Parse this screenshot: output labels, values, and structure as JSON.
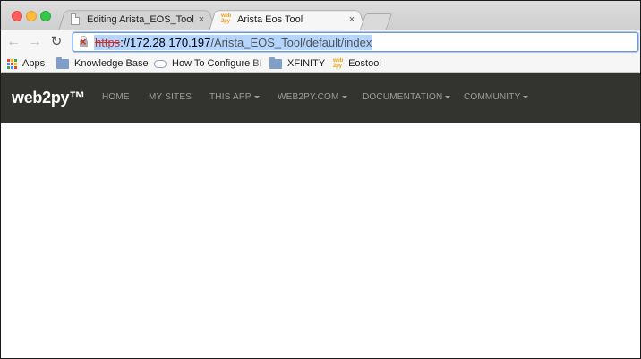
{
  "browser": {
    "tabs": [
      {
        "title": "Editing Arista_EOS_Tool",
        "favicon": "document-icon",
        "close": "×"
      },
      {
        "title": "Arista Eos Tool",
        "favicon": "web2py-icon",
        "close": "×"
      }
    ],
    "address": {
      "scheme": "https",
      "host": "://172.28.170.197",
      "path": "/Arista_EOS_Tool/default/index"
    },
    "bookmarks": [
      {
        "label": "Apps",
        "icon": "apps-grid-icon"
      },
      {
        "label": "Knowledge Base",
        "icon": "folder-icon"
      },
      {
        "label": "How To Configure BI",
        "icon": "cloud-icon"
      },
      {
        "label": "XFINITY",
        "icon": "folder-icon"
      },
      {
        "label": "Eostool",
        "icon": "web2py-icon"
      }
    ],
    "favicon_text": {
      "line1": "web",
      "line2": "2py"
    }
  },
  "navbar": {
    "brand": "web2py™",
    "links": [
      {
        "label": "HOME",
        "dropdown": false
      },
      {
        "label": "MY SITES",
        "dropdown": false
      },
      {
        "label": "THIS APP",
        "dropdown": true
      },
      {
        "label": "WEB2PY.COM",
        "dropdown": true
      },
      {
        "label": "DOCUMENTATION",
        "dropdown": true
      },
      {
        "label": "COMMUNITY",
        "dropdown": true
      }
    ]
  },
  "colors": {
    "navbar_bg": "#333330",
    "navbar_link": "#9d9d9d",
    "url_selection": "#b4d5fe",
    "insecure_red": "#c9302c"
  }
}
